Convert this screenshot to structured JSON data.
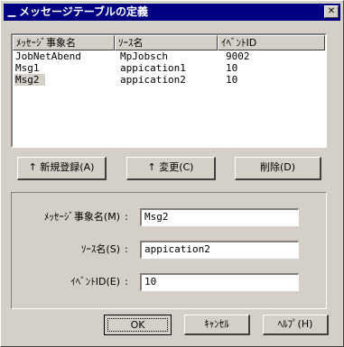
{
  "window": {
    "title": "メッセージテーブルの定義"
  },
  "list": {
    "columns": [
      "ﾒｯｾｰｼﾞ事象名",
      "ｿｰｽ名",
      "ｲﾍﾞﾝﾄID"
    ],
    "rows": [
      [
        "JobNetAbend",
        "MpJobsch",
        "9002"
      ],
      [
        "Msg1",
        "appication1",
        "10"
      ],
      [
        "Msg2",
        "appication2",
        "10"
      ]
    ]
  },
  "actions": {
    "add": "↑ 新規登録(A)",
    "change": "↑ 変更(C)",
    "delete": "削除(D)"
  },
  "form": {
    "event_label": "ﾒｯｾｰｼﾞ事象名(M)",
    "event_value": "Msg2",
    "source_label": "ｿｰｽ名(S)",
    "source_value": "appication2",
    "id_label": "ｲﾍﾞﾝﾄID(E)",
    "id_value": "10",
    "colon": ":"
  },
  "footer": {
    "ok": "OK",
    "cancel": "ｷｬﾝｾﾙ",
    "help": "ﾍﾙﾌﾟ(H)"
  }
}
